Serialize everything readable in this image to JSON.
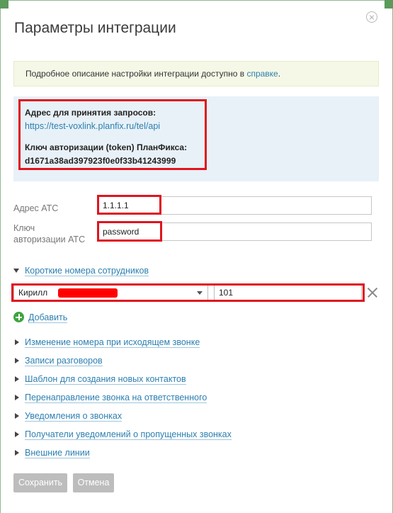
{
  "dialog": {
    "title": "Параметры интеграции"
  },
  "info": {
    "text": "Подробное описание настройки интеграции доступно в ",
    "link": "справке",
    "tail": "."
  },
  "endpoint": {
    "address_label": "Адрес для принятия запросов:",
    "address_url": "https://test-voxlink.planfix.ru/tel/api",
    "token_label": "Ключ авторизации (token) ПланФикса:",
    "token_value": "d1671a38ad397923f0e0f33b41243999"
  },
  "form": {
    "ats_address_label": "Адрес АТС",
    "ats_address_value": "1.1.1.1",
    "ats_key_label_line1": "Ключ",
    "ats_key_label_line2": "авторизации АТС",
    "ats_key_value": "password"
  },
  "short_numbers": {
    "section_label": "Короткие номера сотрудников",
    "employee_select": "Кирилл",
    "number_value": "101",
    "add_label": "Добавить"
  },
  "sections": [
    "Изменение номера при исходящем звонке",
    "Записи разговоров",
    "Шаблон для создания новых контактов",
    "Перенаправление звонка на ответственного",
    "Уведомления о звонках",
    "Получатели уведомлений о пропущенных звонках",
    "Внешние линии"
  ],
  "buttons": {
    "save": "Сохранить",
    "cancel": "Отмена"
  },
  "colors": {
    "link": "#2c7fb0",
    "highlight": "#e0141e",
    "add_green": "#3ea43e"
  }
}
